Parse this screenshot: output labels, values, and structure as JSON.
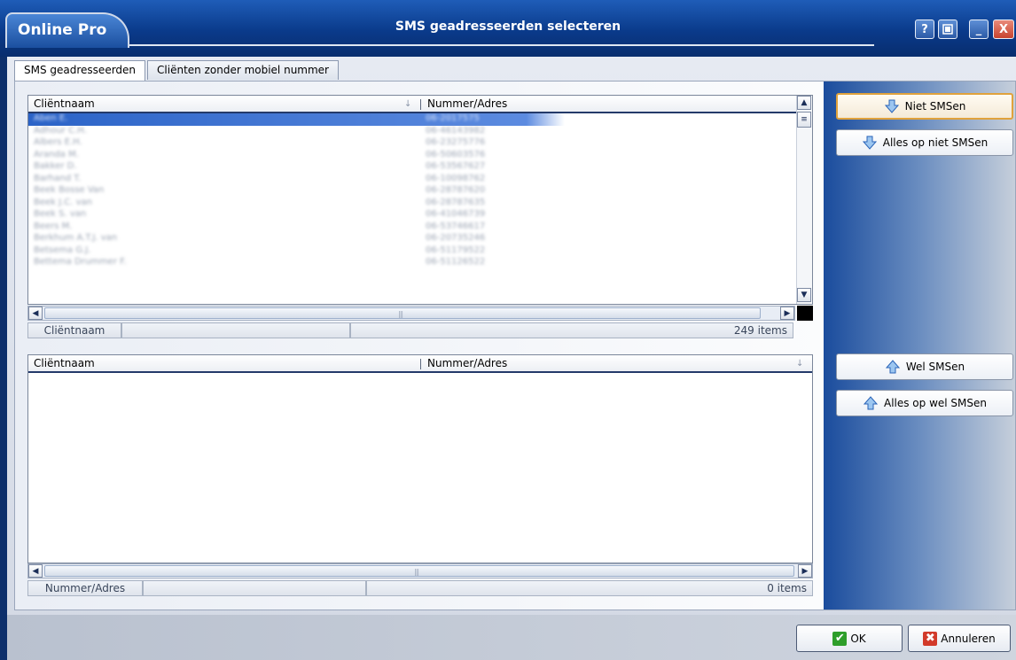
{
  "window": {
    "brand": "Online Pro",
    "title": "SMS geadresseerden selecteren",
    "help_glyph": "?",
    "min_glyph": "_",
    "close_glyph": "X"
  },
  "tabs": [
    {
      "label": "SMS geadresseerden",
      "active": true
    },
    {
      "label": "Cliënten zonder mobiel nummer",
      "active": false
    }
  ],
  "top_grid": {
    "col1": "Cliëntnaam",
    "col2": "Nummer/Adres",
    "rows": [
      {
        "name": "Aben E.",
        "number": "06-2017575",
        "selected": true
      },
      {
        "name": "Adhour C.H.",
        "number": "06-46143982"
      },
      {
        "name": "Albers E.H.",
        "number": "06-23275776"
      },
      {
        "name": "Aranda M.",
        "number": "06-50603576"
      },
      {
        "name": "Bakker D.",
        "number": "06-53567627"
      },
      {
        "name": "Barhand T.",
        "number": "06-10098762"
      },
      {
        "name": "Beek Bosse Van",
        "number": "06-28787620"
      },
      {
        "name": "Beek J.C. van",
        "number": "06-28787635"
      },
      {
        "name": "Beek S. van",
        "number": "06-41046739"
      },
      {
        "name": "Beers M.",
        "number": "06-53746617"
      },
      {
        "name": "Berkhum A.T.J. van",
        "number": "06-20735246"
      },
      {
        "name": "Betsema G.J.",
        "number": "06-51179522"
      },
      {
        "name": "Bettema Drummer F.",
        "number": "06-51126522"
      }
    ],
    "status_label": "Cliëntnaam",
    "count": "249 items"
  },
  "bottom_grid": {
    "col1": "Cliëntnaam",
    "col2": "Nummer/Adres",
    "status_label": "Nummer/Adres",
    "count": "0 items"
  },
  "actions": {
    "niet_smsen": "Niet SMSen",
    "alles_niet": "Alles op niet SMSen",
    "wel_smsen": "Wel SMSen",
    "alles_wel": "Alles op wel SMSen"
  },
  "dialog": {
    "ok": "OK",
    "cancel": "Annuleren"
  },
  "colors": {
    "title_bar": "#0a3a8a",
    "selection": "#2b63c7",
    "focus_border": "#e0a23c",
    "ok_check": "#2e9e2a",
    "cancel_x": "#d23a2a"
  },
  "icons": {
    "move_down": "arrow-down-icon",
    "move_up": "arrow-up-icon",
    "ok": "check-icon",
    "cancel": "x-icon"
  }
}
